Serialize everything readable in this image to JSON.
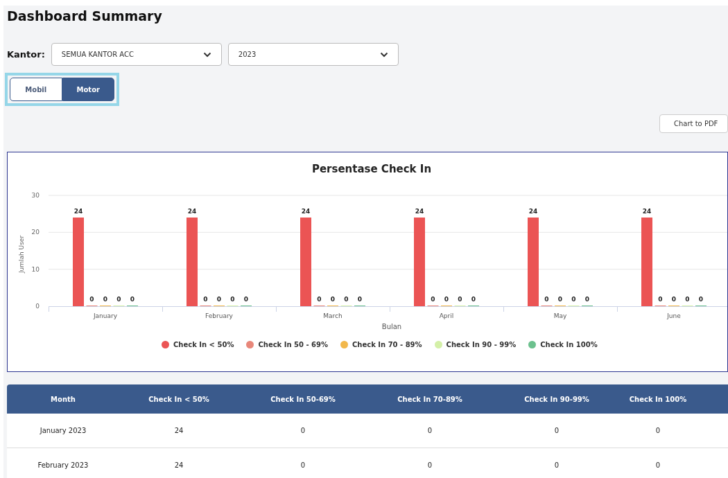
{
  "title": "Dashboard Summary",
  "filters": {
    "label": "Kantor:",
    "selects": [
      {
        "value": "SEMUA KANTOR ACC"
      },
      {
        "value": "2023"
      }
    ]
  },
  "vehicle_tabs": [
    {
      "label": "Mobil",
      "selected": false
    },
    {
      "label": "Motor",
      "selected": true
    }
  ],
  "export_button": "Chart to PDF",
  "chart": {
    "chart_data": {
      "type": "bar",
      "title": "Persentase Check In",
      "xlabel": "Bulan",
      "ylabel": "Jumlah User",
      "categories": [
        "January",
        "February",
        "March",
        "April",
        "May",
        "June"
      ],
      "series": [
        {
          "name": "Check In < 50%",
          "color": "#eb5454",
          "values": [
            24,
            24,
            24,
            24,
            24,
            24
          ]
        },
        {
          "name": "Check In 50 - 69%",
          "color": "#e8877a",
          "values": [
            0,
            0,
            0,
            0,
            0,
            0
          ]
        },
        {
          "name": "Check In 70 - 89%",
          "color": "#f2b84b",
          "values": [
            0,
            0,
            0,
            0,
            0,
            0
          ]
        },
        {
          "name": "Check In 90 - 99%",
          "color": "#d4f0a8",
          "values": [
            0,
            0,
            0,
            0,
            0,
            0
          ]
        },
        {
          "name": "Check In 100%",
          "color": "#6cc18e",
          "values": [
            0,
            0,
            0,
            0,
            0,
            0
          ]
        }
      ],
      "ylim": [
        0,
        30
      ],
      "yticks": [
        0,
        10,
        20,
        30
      ],
      "data_labels": true
    }
  },
  "table": {
    "columns": [
      "Month",
      "Check In < 50%",
      "Check In 50-69%",
      "Check In 70-89%",
      "Check In 90-99%",
      "Check In 100%"
    ],
    "rows": [
      [
        "January 2023",
        "24",
        "0",
        "0",
        "0",
        "0"
      ],
      [
        "February 2023",
        "24",
        "0",
        "0",
        "0",
        "0"
      ]
    ]
  }
}
